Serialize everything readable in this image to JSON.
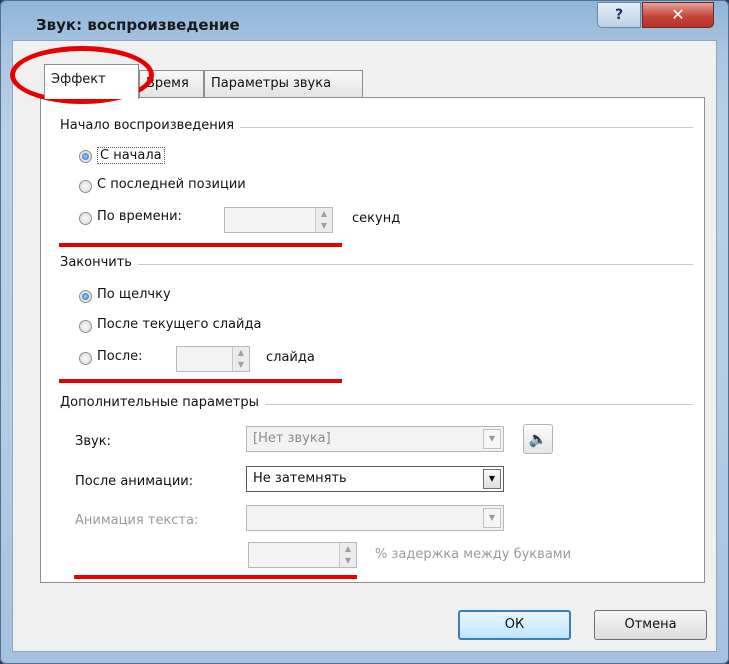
{
  "window": {
    "title": "Звук: воспроизведение",
    "help_label": "?",
    "close_label": "✕"
  },
  "tabs": [
    {
      "label": "Эффект",
      "active": true
    },
    {
      "label": "Время",
      "active": false
    },
    {
      "label": "Параметры звука",
      "active": false
    }
  ],
  "start_group": {
    "title": "Начало воспроизведения",
    "options": [
      {
        "label": "С начала",
        "selected": true
      },
      {
        "label": "С последней позиции",
        "selected": false
      },
      {
        "label": "По времени:",
        "selected": false
      }
    ],
    "time_value": "",
    "time_unit": "секунд"
  },
  "finish_group": {
    "title": "Закончить",
    "options": [
      {
        "label": "По щелчку",
        "selected": true
      },
      {
        "label": "После текущего слайда",
        "selected": false
      },
      {
        "label": "После:",
        "selected": false
      }
    ],
    "slides_value": "",
    "slides_unit": "слайда"
  },
  "extra_group": {
    "title": "Дополнительные параметры",
    "sound_label": "Звук:",
    "sound_value": "[Нет звука]",
    "after_anim_label": "После анимации:",
    "after_anim_value": "Не затемнять",
    "text_anim_label": "Анимация текста:",
    "text_anim_value": "",
    "delay_value": "",
    "delay_label": "% задержка между буквами"
  },
  "buttons": {
    "ok": "ОК",
    "cancel": "Отмена"
  },
  "icons": {
    "speaker": "speaker-icon",
    "spin_up": "▲",
    "spin_down": "▼",
    "dropdown": "▼"
  },
  "colors": {
    "annotation": "#e60000",
    "title_bar": "#a9c6e2",
    "close_button": "#c4463a",
    "selected_radio": "#1f5fbf"
  }
}
